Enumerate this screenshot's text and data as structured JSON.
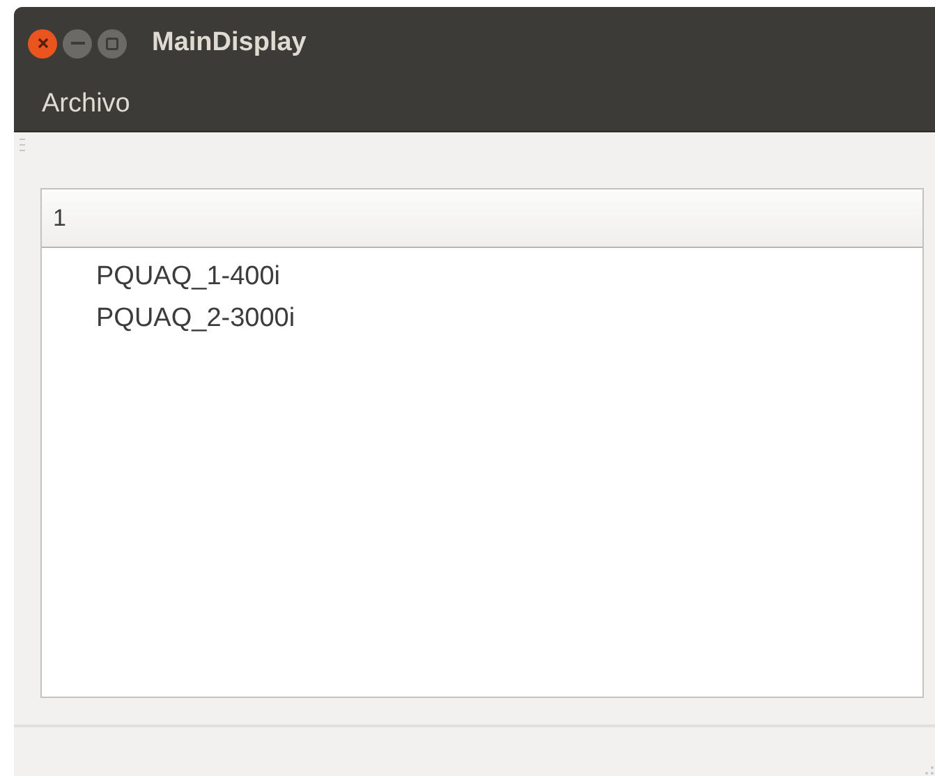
{
  "window": {
    "title": "MainDisplay"
  },
  "menu": [
    "Archivo"
  ],
  "tree": {
    "columns": [
      "1"
    ],
    "items": [
      {
        "label": "PQUAQ_1-400i"
      },
      {
        "label": "PQUAQ_2-3000i"
      }
    ]
  }
}
